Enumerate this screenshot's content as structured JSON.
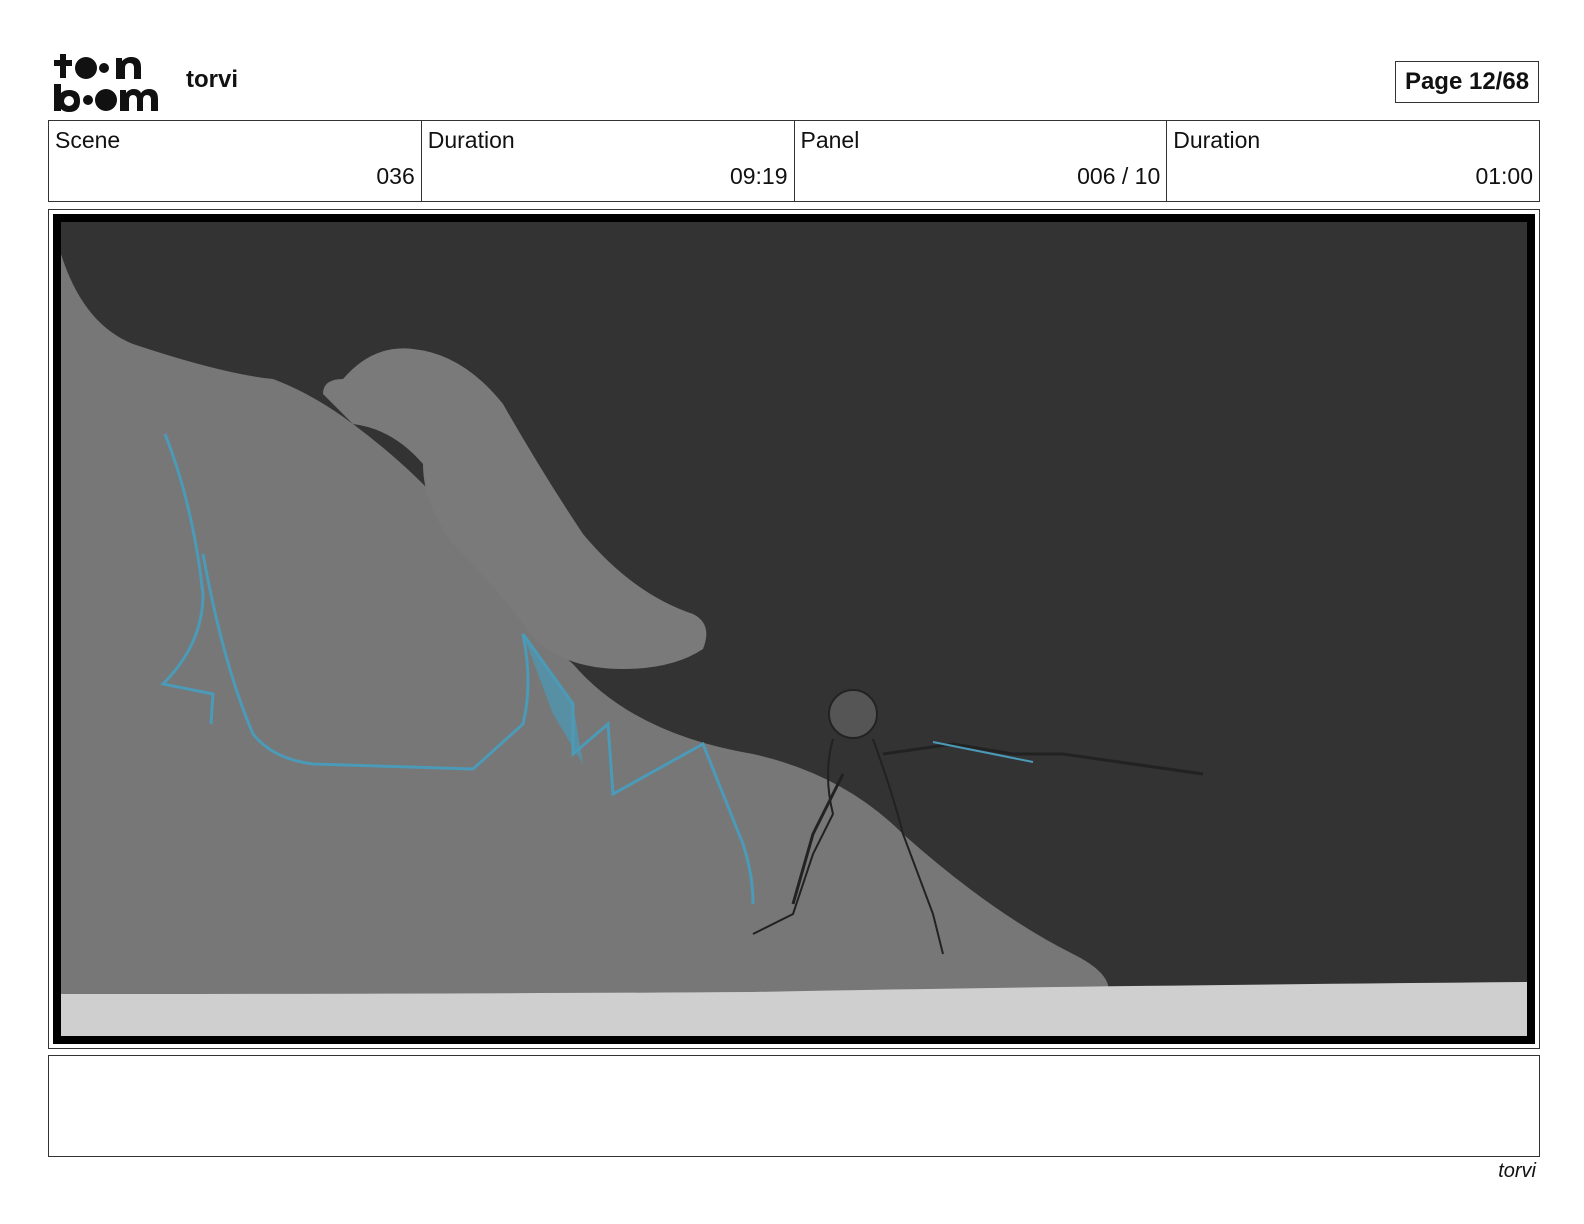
{
  "header": {
    "logo_icon": "toon-boom-logo",
    "logo_text": "toon boom",
    "project_title": "torvi",
    "page_label": "Page 12/68"
  },
  "info": {
    "scene_label": "Scene",
    "scene_value": "036",
    "scene_duration_label": "Duration",
    "scene_duration_value": "09:19",
    "panel_label": "Panel",
    "panel_value": "006 / 10",
    "panel_duration_label": "Duration",
    "panel_duration_value": "01:00"
  },
  "panel": {
    "image": "storyboard-panel-warrior-with-sword-on-hillside",
    "colors": {
      "background": "#333333",
      "hill": "#777777",
      "ground": "#cfcfcf",
      "lightning": "#4a9ab8"
    }
  },
  "notes": {
    "text": ""
  },
  "footer": {
    "project_name": "torvi"
  }
}
